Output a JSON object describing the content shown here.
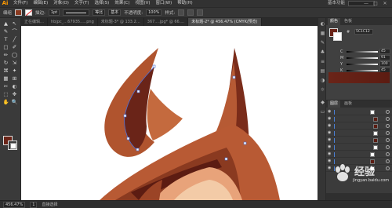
{
  "app": {
    "logo": "Ai"
  },
  "menu": [
    "文件(F)",
    "编辑(E)",
    "对象(O)",
    "文字(T)",
    "选择(S)",
    "效果(C)",
    "视图(V)",
    "窗口(W)",
    "帮助(H)"
  ],
  "workspace_label": "基本功能",
  "window_controls": [
    "—",
    "□",
    "✕"
  ],
  "control_bar": {
    "selection_label": "编组",
    "stroke_label": "描边:",
    "stroke_weight": "1pt",
    "stroke_profile": "等比",
    "brush_value": "基本",
    "opacity_label": "不透明度:",
    "opacity_value": "100%",
    "style_label": "样式:"
  },
  "tabs": [
    {
      "label": "正在编辑…",
      "active": false
    },
    {
      "label": "hbjpc_…67935..…png",
      "active": false
    },
    {
      "label": "未标题-3* @ 133.2…",
      "active": false
    },
    {
      "label": "367.…jpg* @ 66.…",
      "active": false
    },
    {
      "label": "未标题-2* @ 456.47% (CMYK/预览)",
      "active": true
    }
  ],
  "tools": [
    "▲",
    "↖",
    "✎",
    "⌒",
    "T",
    "╱",
    "□",
    "✐",
    "✏",
    "◯",
    "↻",
    "⇲",
    "⌘",
    "✦",
    "▦",
    "⊞",
    "✂",
    "◐",
    "⬚",
    "✥",
    "✋",
    "🔍"
  ],
  "status_bar": {
    "zoom": "456.47%",
    "page": "1",
    "tool_name": "直接选择"
  },
  "color_panel": {
    "tabs": [
      "颜色",
      "色板"
    ],
    "hex_label": "#",
    "hex_value": "5C1C12",
    "channels": [
      {
        "label": "C",
        "value": "45"
      },
      {
        "label": "M",
        "value": "91"
      },
      {
        "label": "Y",
        "value": "100"
      },
      {
        "label": "K",
        "value": "45"
      }
    ],
    "fill_color": "#6a2418"
  },
  "layers_panel": {
    "tabs": [
      "图层",
      "画板"
    ],
    "row_count": 9
  },
  "watermark": {
    "brand": "经验",
    "sub": "jingyan.baidu.com"
  },
  "colors": {
    "accent": "#ff9a00",
    "brown_dark": "#5c1c12",
    "brown_mid": "#8a3a20",
    "brown_light": "#b85a34",
    "peach": "#e8a37a",
    "cream": "#f3cba7"
  }
}
